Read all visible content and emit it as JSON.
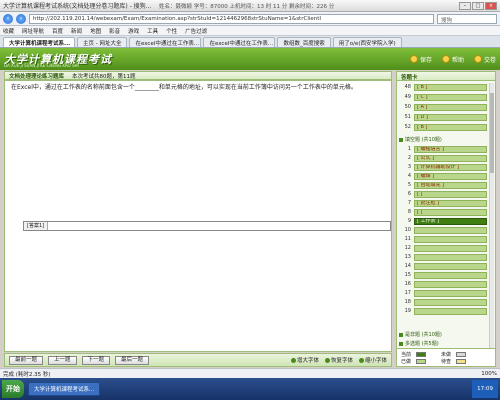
{
  "titlebar": {
    "title": "大学计算机课程考试系统(文档处理分卷习题库) - 搜狗高速浏览器",
    "info": "姓名：聂微颖    学号：87000    上机时间：13 时 11 分    剩余时间：226 分"
  },
  "address": {
    "url": "http://202.119.201.14/webexam/Exam/Examination.asp?strStuId=1214462968strStuName=1&strClientI",
    "search_placeholder": "搜狗"
  },
  "favorites": [
    "收藏",
    "网址导航",
    "百度",
    "新闻",
    "地图",
    "影音",
    "游戏",
    "工具",
    "个性",
    "广告过滤"
  ],
  "tabs": [
    {
      "label": "大学计算机课程考试系...",
      "active": true
    },
    {
      "label": "主页 - 网址大全",
      "active": false
    },
    {
      "label": "在excel中通过在工作表...",
      "active": false
    },
    {
      "label": "在excel中通过在工作表...",
      "active": false
    },
    {
      "label": "数组数_百度搜索",
      "active": false
    },
    {
      "label": "用了o/e(西安学院入学)",
      "active": false
    }
  ],
  "exam": {
    "logo": "大学计算机课程考试",
    "logo_sub": "DA XUE JI SUAN JI KE CHENG KAO SHI",
    "buttons": {
      "save": "保存",
      "help": "帮助",
      "submit": "交卷"
    }
  },
  "question": {
    "header_title": "文档处理理论练习题库",
    "header_info": "本次考试共80题，第11题",
    "text": "在Excel中，通过在工作表的名称前面包含一个________和单元格的地址，可以实现在当前工作簿中访问另一个工作表中的单元格。",
    "answer_label": "[答案1]",
    "answer_value": ""
  },
  "bottom": {
    "first": "最前一题",
    "prev": "上一题",
    "next": "下一题",
    "last": "最后一题",
    "font_big": "增大字体",
    "font_default": "恢复字体",
    "font_small": "缩小字体"
  },
  "card": {
    "title": "答题卡",
    "rows_top": [
      {
        "num": "48",
        "text": "[ B ]"
      },
      {
        "num": "49",
        "text": "[ C ]"
      },
      {
        "num": "50",
        "text": "[ A ]"
      },
      {
        "num": "51",
        "text": "[ D ]"
      },
      {
        "num": "52",
        "text": "[ B ]"
      }
    ],
    "fill_section": "填空题 (共10题)",
    "fill_rows": [
      {
        "num": "1",
        "text": "[ 编程语言 ]"
      },
      {
        "num": "2",
        "text": "[ 公式 ]"
      },
      {
        "num": "3",
        "text": "[ 计算机辅助设计 ]"
      },
      {
        "num": "4",
        "text": "[ 编辑 ]"
      },
      {
        "num": "5",
        "text": "[ 自动填充 ]"
      },
      {
        "num": "6",
        "text": "[ ]"
      },
      {
        "num": "7",
        "text": "[ 批注框 ]"
      },
      {
        "num": "8",
        "text": "[ ]"
      },
      {
        "num": "9",
        "text": "[ 工作表 ]"
      },
      {
        "num": "10",
        "text": ""
      },
      {
        "num": "11",
        "text": ""
      },
      {
        "num": "12",
        "text": ""
      },
      {
        "num": "13",
        "text": ""
      },
      {
        "num": "14",
        "text": ""
      },
      {
        "num": "15",
        "text": ""
      },
      {
        "num": "16",
        "text": ""
      },
      {
        "num": "17",
        "text": ""
      },
      {
        "num": "18",
        "text": ""
      },
      {
        "num": "19",
        "text": ""
      }
    ],
    "tf_section": "是非题 (共10题)",
    "mc_section": "多选题 (共5题)",
    "legend": {
      "current": "当前",
      "unanswered": "未做",
      "answered": "已做",
      "pending": "待查"
    },
    "colors": {
      "current": "#3f7f12",
      "unanswered": "#d8d8d8",
      "answered": "#b9d68a",
      "pending": "#f0e08a"
    }
  },
  "statusbar": {
    "left": "完成 (耗时2.35 秒)",
    "zoom": "100%"
  },
  "taskbar": {
    "start": "开始",
    "item": "大学计算机课程考试系...",
    "time": "17:09"
  }
}
